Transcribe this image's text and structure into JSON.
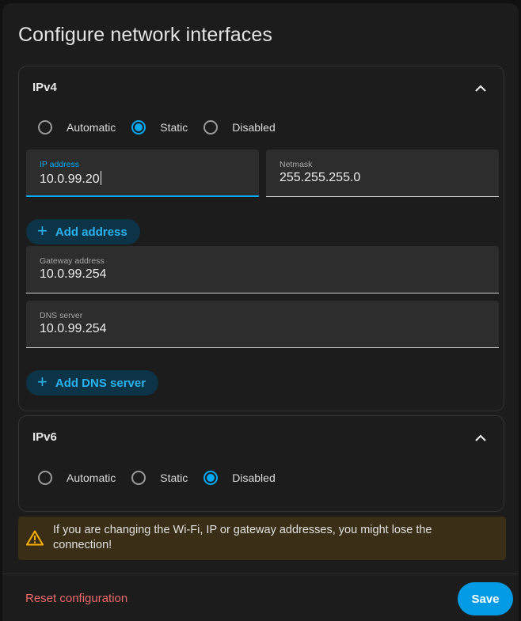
{
  "dialog": {
    "title": "Configure network interfaces"
  },
  "ipv4": {
    "heading": "IPv4",
    "toggle_icon": "chevron-up-icon",
    "modes": [
      {
        "label": "Automatic",
        "selected": false
      },
      {
        "label": "Static",
        "selected": true
      },
      {
        "label": "Disabled",
        "selected": false
      }
    ],
    "ip_address": {
      "label": "IP address",
      "value": "10.0.99.20",
      "focused": true
    },
    "netmask": {
      "label": "Netmask",
      "value": "255.255.255.0"
    },
    "add_address_label": "Add address",
    "gateway": {
      "label": "Gateway address",
      "value": "10.0.99.254"
    },
    "dns": {
      "label": "DNS server",
      "value": "10.0.99.254"
    },
    "add_dns_label": "Add DNS server"
  },
  "ipv6": {
    "heading": "IPv6",
    "toggle_icon": "chevron-up-icon",
    "modes": [
      {
        "label": "Automatic",
        "selected": false
      },
      {
        "label": "Static",
        "selected": false
      },
      {
        "label": "Disabled",
        "selected": true
      }
    ]
  },
  "warning": {
    "icon": "warning-icon",
    "text": "If you are changing the Wi-Fi, IP or gateway addresses, you might lose the connection!"
  },
  "footer": {
    "reset_label": "Reset configuration",
    "save_label": "Save"
  },
  "colors": {
    "accent": "#03a9f4",
    "danger": "#ef6a6a",
    "warning": "#ffb000",
    "surface": "#1c1c1c"
  }
}
